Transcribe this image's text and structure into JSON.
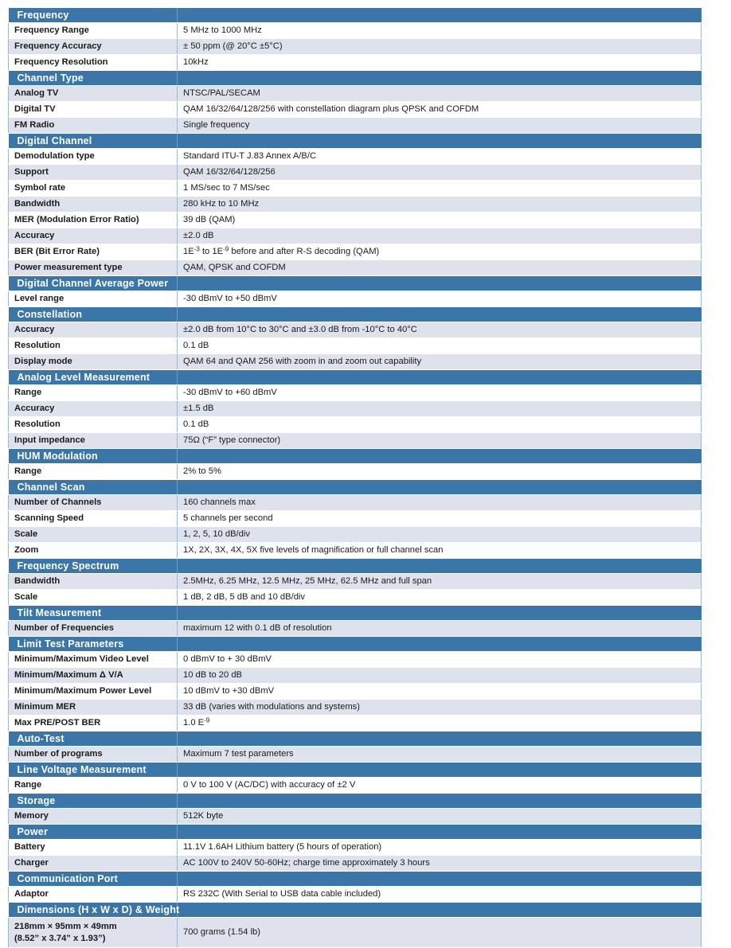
{
  "document": {
    "kind": "product-specification-table",
    "accent_color": "#3a76a8",
    "shade_color": "#dde2ed",
    "border_color": "#9fb6cd"
  },
  "sections": [
    {
      "title": "Frequency",
      "rows": [
        {
          "label": "Frequency Range",
          "value": "5 MHz to 1000 MHz"
        },
        {
          "label": "Frequency Accuracy",
          "value": "± 50 ppm (@ 20°C ±5°C)"
        },
        {
          "label": "Frequency Resolution",
          "value": "10kHz"
        }
      ]
    },
    {
      "title": "Channel Type",
      "rows": [
        {
          "label": "Analog TV",
          "value": "NTSC/PAL/SECAM"
        },
        {
          "label": "Digital TV",
          "value": "QAM 16/32/64/128/256 with constellation diagram plus QPSK and COFDM"
        },
        {
          "label": "FM Radio",
          "value": "Single frequency"
        }
      ]
    },
    {
      "title": "Digital Channel",
      "rows": [
        {
          "label": "Demodulation type",
          "value": "Standard ITU-T J.83 Annex A/B/C"
        },
        {
          "label": "Support",
          "value": "QAM 16/32/64/128/256"
        },
        {
          "label": "Symbol rate",
          "value": "1 MS/sec to 7 MS/sec"
        },
        {
          "label": "Bandwidth",
          "value": "280 kHz to 10 MHz"
        },
        {
          "label": "MER (Modulation Error Ratio)",
          "value": "39 dB (QAM)"
        },
        {
          "label": "Accuracy",
          "value": "±2.0 dB"
        },
        {
          "label": "BER (Bit Error Rate)",
          "value_html": "1E<sup>-3</sup> to 1E<sup>-9</sup> before and after R-S decoding (QAM)"
        },
        {
          "label": "Power measurement type",
          "value": "QAM, QPSK and COFDM"
        }
      ]
    },
    {
      "title": "Digital Channel Average Power",
      "rows": [
        {
          "label": "Level range",
          "value": "-30 dBmV to +50 dBmV"
        }
      ]
    },
    {
      "title": "Constellation",
      "rows": [
        {
          "label": "Accuracy",
          "value": "±2.0 dB from 10°C to 30°C and ±3.0 dB from -10°C to 40°C"
        },
        {
          "label": "Resolution",
          "value": "0.1 dB"
        },
        {
          "label": "Display mode",
          "value": "QAM 64 and QAM 256 with zoom in and zoom out capability"
        }
      ]
    },
    {
      "title": "Analog Level Measurement",
      "rows": [
        {
          "label": "Range",
          "value": "-30 dBmV to +60 dBmV"
        },
        {
          "label": "Accuracy",
          "value": "±1.5 dB"
        },
        {
          "label": "Resolution",
          "value": "0.1 dB"
        },
        {
          "label": "Input impedance",
          "value": "75Ω (“F” type connector)"
        }
      ]
    },
    {
      "title": "HUM Modulation",
      "rows": [
        {
          "label": "Range",
          "value": "2% to 5%"
        }
      ]
    },
    {
      "title": "Channel Scan",
      "rows": [
        {
          "label": "Number of Channels",
          "value": "160 channels max"
        },
        {
          "label": "Scanning Speed",
          "value": "5 channels per second"
        },
        {
          "label": "Scale",
          "value": "1, 2, 5, 10 dB/div"
        },
        {
          "label": "Zoom",
          "value": "1X, 2X, 3X, 4X, 5X five levels of magnification or full channel scan"
        }
      ]
    },
    {
      "title": "Frequency Spectrum",
      "rows": [
        {
          "label": "Bandwidth",
          "value": "2.5MHz, 6.25 MHz, 12.5 MHz, 25 MHz, 62.5 MHz and full span"
        },
        {
          "label": "Scale",
          "value": "1 dB, 2 dB, 5 dB and 10 dB/div"
        }
      ]
    },
    {
      "title": "Tilt Measurement",
      "rows": [
        {
          "label": "Number of Frequencies",
          "value": "maximum 12 with 0.1 dB of resolution"
        }
      ]
    },
    {
      "title": "Limit Test Parameters",
      "rows": [
        {
          "label": "Minimum/Maximum Video Level",
          "value": "0 dBmV to + 30 dBmV"
        },
        {
          "label": "Minimum/Maximum Δ V/A",
          "value": "10 dB to 20 dB"
        },
        {
          "label": "Minimum/Maximum Power Level",
          "value": "10 dBmV to +30 dBmV"
        },
        {
          "label": "Minimum MER",
          "value": "33 dB (varies with modulations and systems)"
        },
        {
          "label": "Max PRE/POST BER",
          "value_html": "1.0 E<sup>-9</sup>"
        }
      ]
    },
    {
      "title": "Auto-Test",
      "rows": [
        {
          "label": "Number of programs",
          "value": "Maximum 7 test parameters"
        }
      ]
    },
    {
      "title": "Line Voltage Measurement",
      "rows": [
        {
          "label": "Range",
          "value": "0 V to 100 V (AC/DC) with accuracy of ±2 V"
        }
      ]
    },
    {
      "title": "Storage",
      "rows": [
        {
          "label": "Memory",
          "value": "512K byte"
        }
      ]
    },
    {
      "title": "Power",
      "rows": [
        {
          "label": "Battery",
          "value": "11.1V  1.6AH Lithium battery (5 hours of operation)"
        },
        {
          "label": "Charger",
          "value": "AC 100V to 240V 50-60Hz; charge time approximately 3 hours"
        }
      ]
    },
    {
      "title": "Communication Port",
      "rows": [
        {
          "label": "Adaptor",
          "value": "RS 232C (With Serial to USB data cable included)"
        }
      ]
    },
    {
      "title": "Dimensions (H x W x D) & Weight",
      "rows": [
        {
          "label_lines": [
            "218mm × 95mm × 49mm",
            "(8.52” x 3.74” x 1.93”)"
          ],
          "value": "700 grams (1.54 lb)",
          "tall": true
        }
      ]
    }
  ]
}
